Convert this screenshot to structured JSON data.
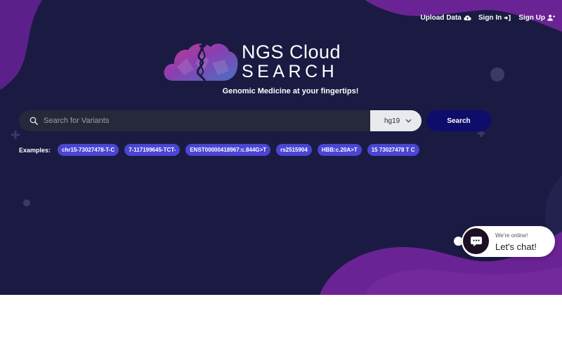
{
  "nav": {
    "upload_label": "Upload Data",
    "signin_label": "Sign In",
    "signup_label": "Sign Up"
  },
  "brand": {
    "line1": "NGS Cloud",
    "line2": "SEARCH",
    "tagline": "Genomic Medicine at your fingertips!"
  },
  "search": {
    "placeholder": "Search for Variants",
    "assembly": "hg19",
    "button_label": "Search"
  },
  "examples": {
    "label": "Examples:",
    "items": [
      "chr15-73027478-T-C",
      "7-117199645-TCT-",
      "ENST00000418967:c.844G>T",
      "rs2515904",
      "HBB:c.20A>T",
      "15 73027478 T C"
    ]
  },
  "chat": {
    "status": "We're online!",
    "cta": "Let's chat!"
  },
  "colors": {
    "background": "#1b1a43",
    "accent_purple": "#6a2394",
    "chip": "#4b45d4",
    "search_button": "#0f0d6b"
  }
}
